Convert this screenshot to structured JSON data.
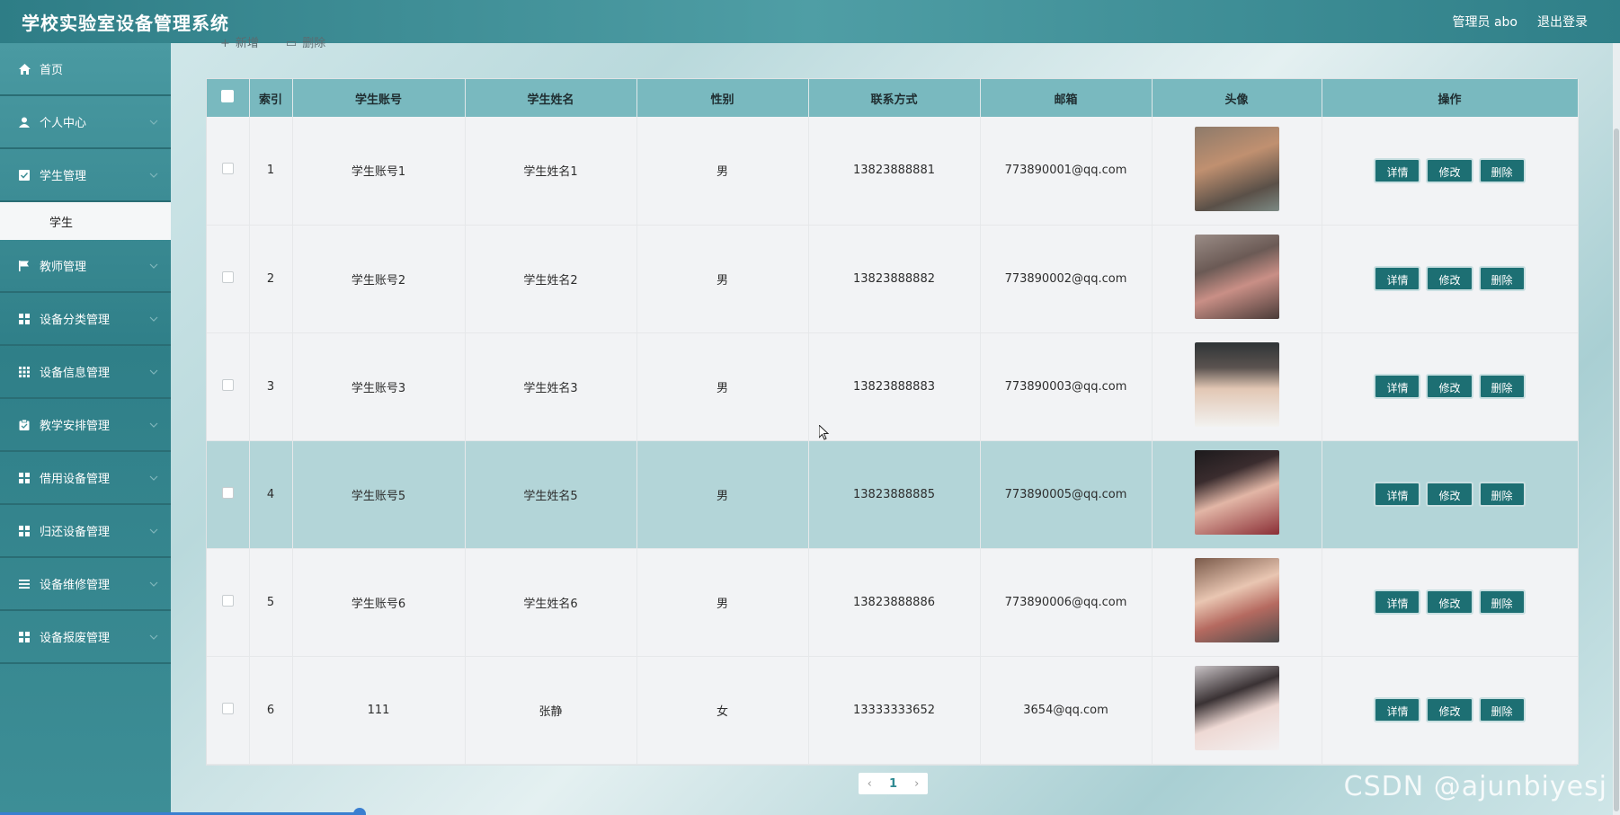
{
  "header": {
    "title": "学校实验室设备管理系统",
    "user_label": "管理员 abo",
    "logout_label": "退出登录"
  },
  "sidebar": {
    "items": [
      {
        "label": "首页",
        "icon": "home-icon"
      },
      {
        "label": "个人中心",
        "icon": "user-icon"
      },
      {
        "label": "学生管理",
        "icon": "checklist-icon"
      },
      {
        "label": "教师管理",
        "icon": "flag-icon"
      },
      {
        "label": "设备分类管理",
        "icon": "grid-icon"
      },
      {
        "label": "设备信息管理",
        "icon": "apps-icon"
      },
      {
        "label": "教学安排管理",
        "icon": "clipboard-icon"
      },
      {
        "label": "借用设备管理",
        "icon": "grid-icon"
      },
      {
        "label": "归还设备管理",
        "icon": "grid-icon"
      },
      {
        "label": "设备维修管理",
        "icon": "list-icon"
      },
      {
        "label": "设备报废管理",
        "icon": "grid-icon"
      }
    ],
    "active_sub": "学生"
  },
  "actions": {
    "add_label": "新增",
    "delete_label": "删除"
  },
  "table": {
    "columns": [
      "索引",
      "学生账号",
      "学生姓名",
      "性别",
      "联系方式",
      "邮箱",
      "头像",
      "操作"
    ],
    "rows": [
      {
        "index": "1",
        "account": "学生账号1",
        "name": "学生姓名1",
        "gender": "男",
        "phone": "13823888881",
        "email": "773890001@qq.com"
      },
      {
        "index": "2",
        "account": "学生账号2",
        "name": "学生姓名2",
        "gender": "男",
        "phone": "13823888882",
        "email": "773890002@qq.com"
      },
      {
        "index": "3",
        "account": "学生账号3",
        "name": "学生姓名3",
        "gender": "男",
        "phone": "13823888883",
        "email": "773890003@qq.com"
      },
      {
        "index": "4",
        "account": "学生账号5",
        "name": "学生姓名5",
        "gender": "男",
        "phone": "13823888885",
        "email": "773890005@qq.com"
      },
      {
        "index": "5",
        "account": "学生账号6",
        "name": "学生姓名6",
        "gender": "男",
        "phone": "13823888886",
        "email": "773890006@qq.com"
      },
      {
        "index": "6",
        "account": "111",
        "name": "张静",
        "gender": "女",
        "phone": "13333333652",
        "email": "3654@qq.com"
      }
    ],
    "buttons": {
      "detail": "详情",
      "edit": "修改",
      "delete": "删除"
    }
  },
  "pagination": {
    "prev": "‹",
    "current": "1",
    "next": "›"
  },
  "watermark": "CSDN @ajunbiyesj",
  "colors": {
    "accent": "#2f7f88",
    "button": "#1d6f73",
    "header_row": "#79b9bf",
    "highlight_row": "#b3d5d8"
  }
}
